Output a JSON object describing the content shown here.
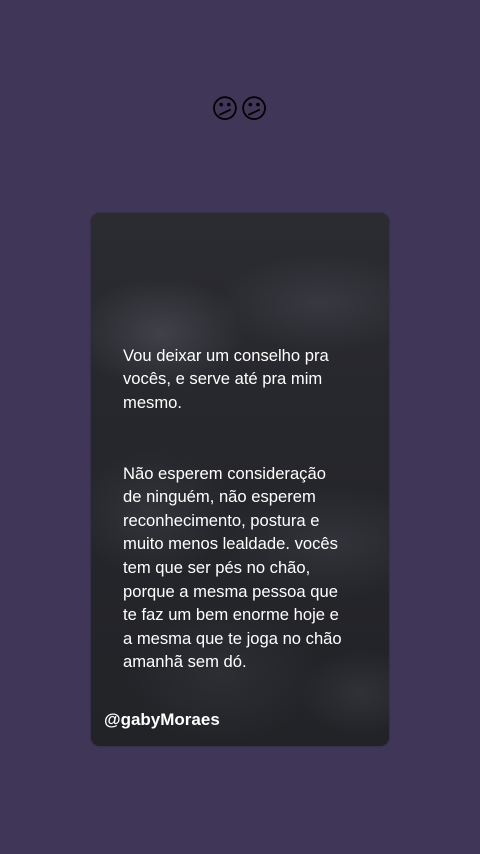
{
  "header": {
    "emojis": [
      "😕",
      "😕"
    ]
  },
  "post": {
    "paragraph_1": "Vou deixar um conselho pra\nvocês, e serve até pra mim\nmesmo.",
    "paragraph_2": "Não esperem consideração\nde ninguém, não esperem\nreconhecimento, postura e\nmuito menos lealdade. vocês\ntem que ser pés no chão,\nporque a mesma pessoa que\nte faz um bem enorme hoje e\na mesma que te joga no chão\namanhã sem dó.",
    "author_handle": "@gabyMoraes"
  },
  "colors": {
    "background": "#403658",
    "card": "#26272c",
    "text": "#ffffff"
  }
}
